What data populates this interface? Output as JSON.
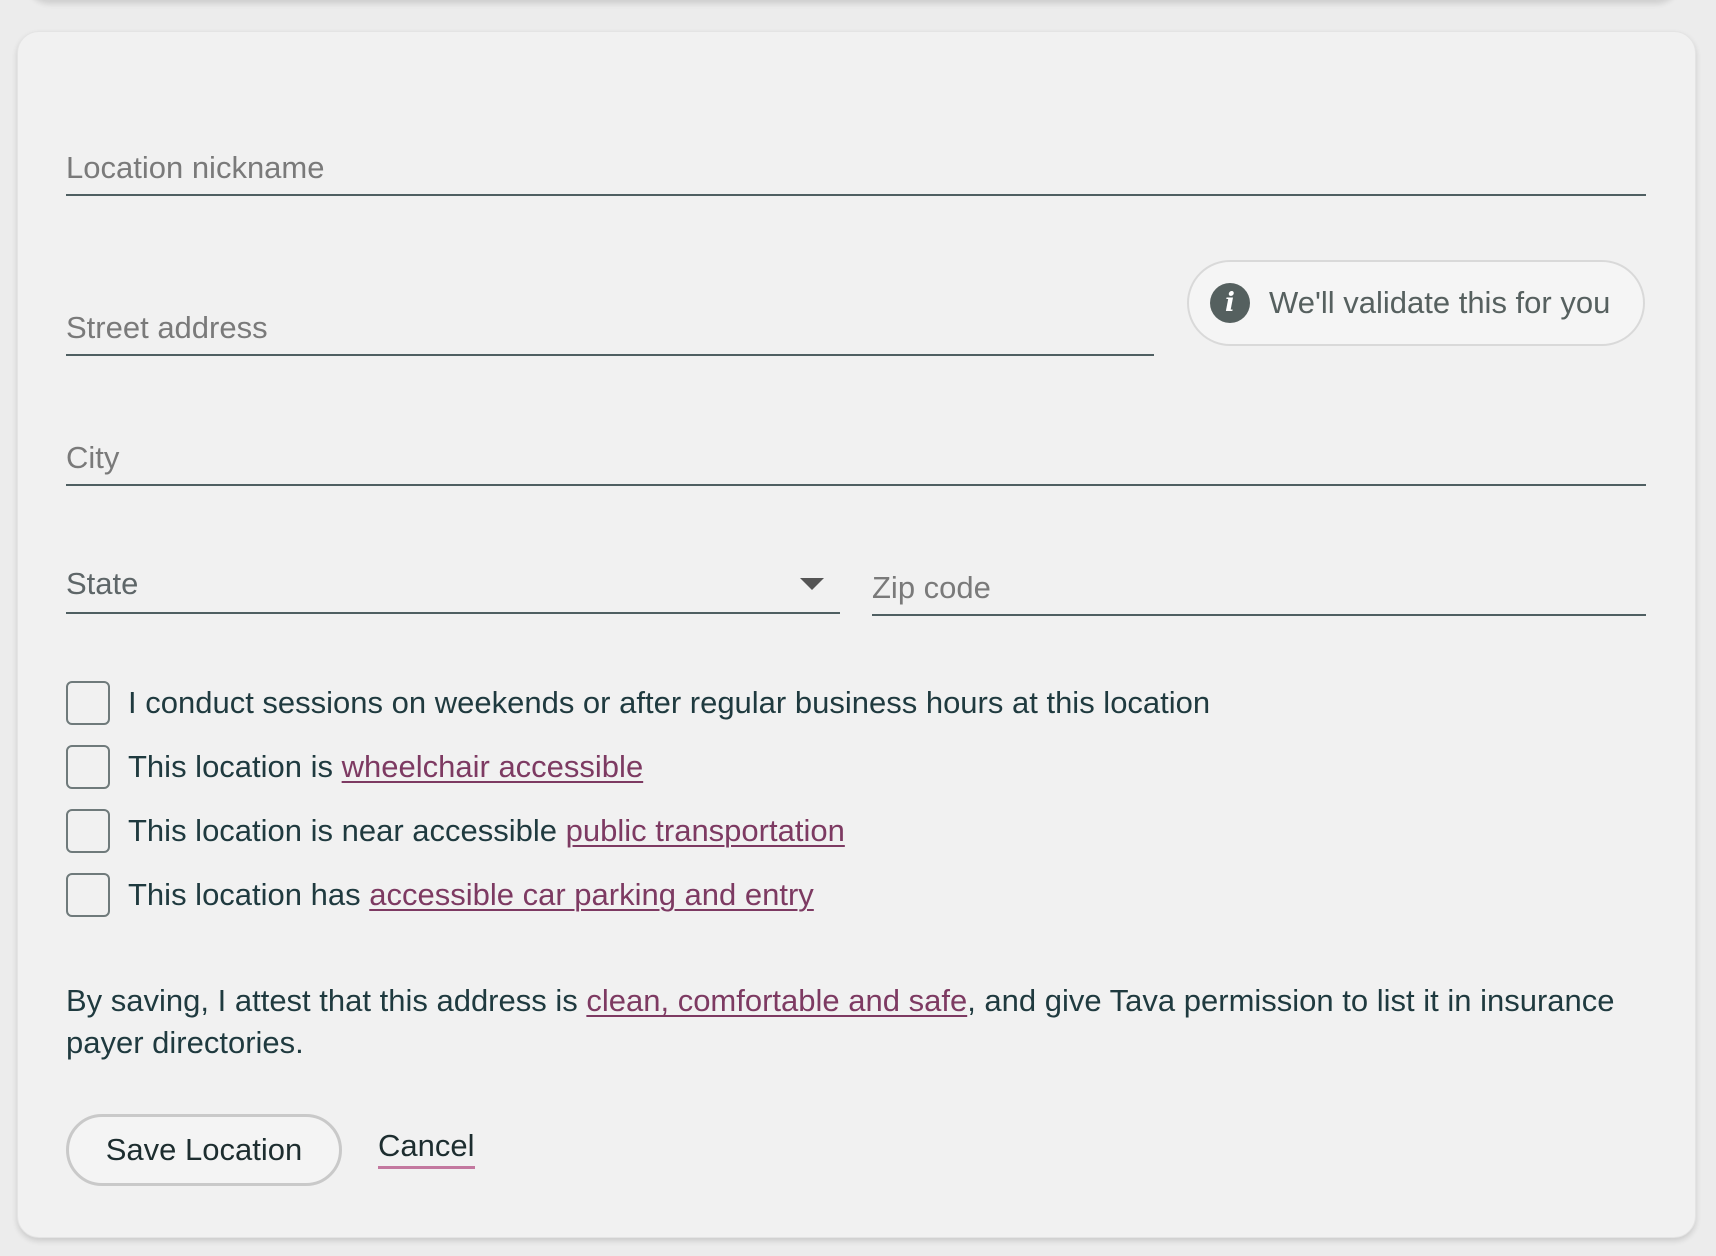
{
  "form": {
    "nickname_placeholder": "Location nickname",
    "street_placeholder": "Street address",
    "street_hint": "We'll validate this for you",
    "city_placeholder": "City",
    "state_label": "State",
    "zip_placeholder": "Zip code"
  },
  "checkboxes": [
    {
      "text": "I conduct sessions on weekends or after regular business hours at this location",
      "link": "",
      "checked": false
    },
    {
      "text": "This location is ",
      "link": "wheelchair accessible",
      "checked": false
    },
    {
      "text": "This location is near accessible ",
      "link": "public transportation",
      "checked": false
    },
    {
      "text": "This location has ",
      "link": "accessible car parking and entry",
      "checked": false
    }
  ],
  "attestation": {
    "prefix": "By saving, I attest that this address is ",
    "link": "clean, comfortable and safe",
    "suffix": ", and give Tava permission to list it in insurance payer directories."
  },
  "actions": {
    "save_label": "Save Location",
    "cancel_label": "Cancel"
  },
  "colors": {
    "link": "#7d3a62",
    "text": "#1f3a3f",
    "cancel_underline": "#c3789f"
  },
  "icons": {
    "hint_icon": "info-icon",
    "state_caret": "caret-down-icon"
  }
}
